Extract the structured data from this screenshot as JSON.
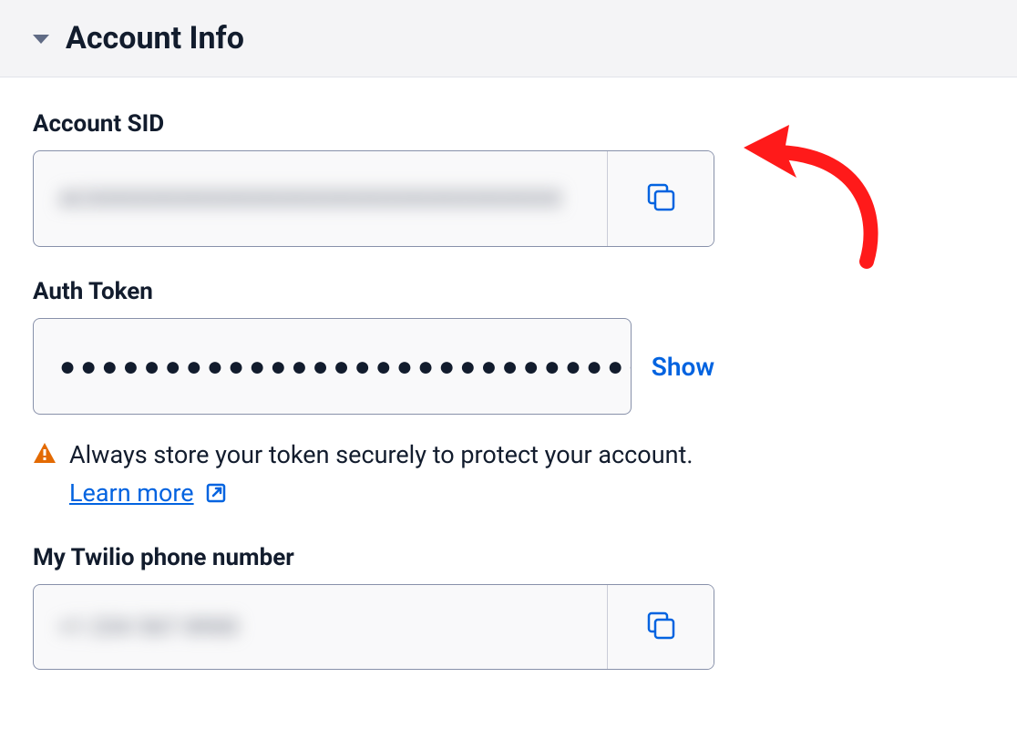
{
  "header": {
    "title": "Account Info"
  },
  "account_sid": {
    "label": "Account SID",
    "value": "ACXXXXXXXXXXXXXXXXXXXXXXXXXXXXXXXX"
  },
  "auth_token": {
    "label": "Auth Token",
    "value": "●●●●●●●●●●●●●●●●●●●●●●●●●●●●●●●●",
    "show_label": "Show"
  },
  "warning": {
    "text_prefix": "Always store your token securely to protect your account. ",
    "learn_more_label": "Learn more"
  },
  "phone": {
    "label": "My Twilio phone number",
    "value": "+1 234 567 8900"
  }
}
